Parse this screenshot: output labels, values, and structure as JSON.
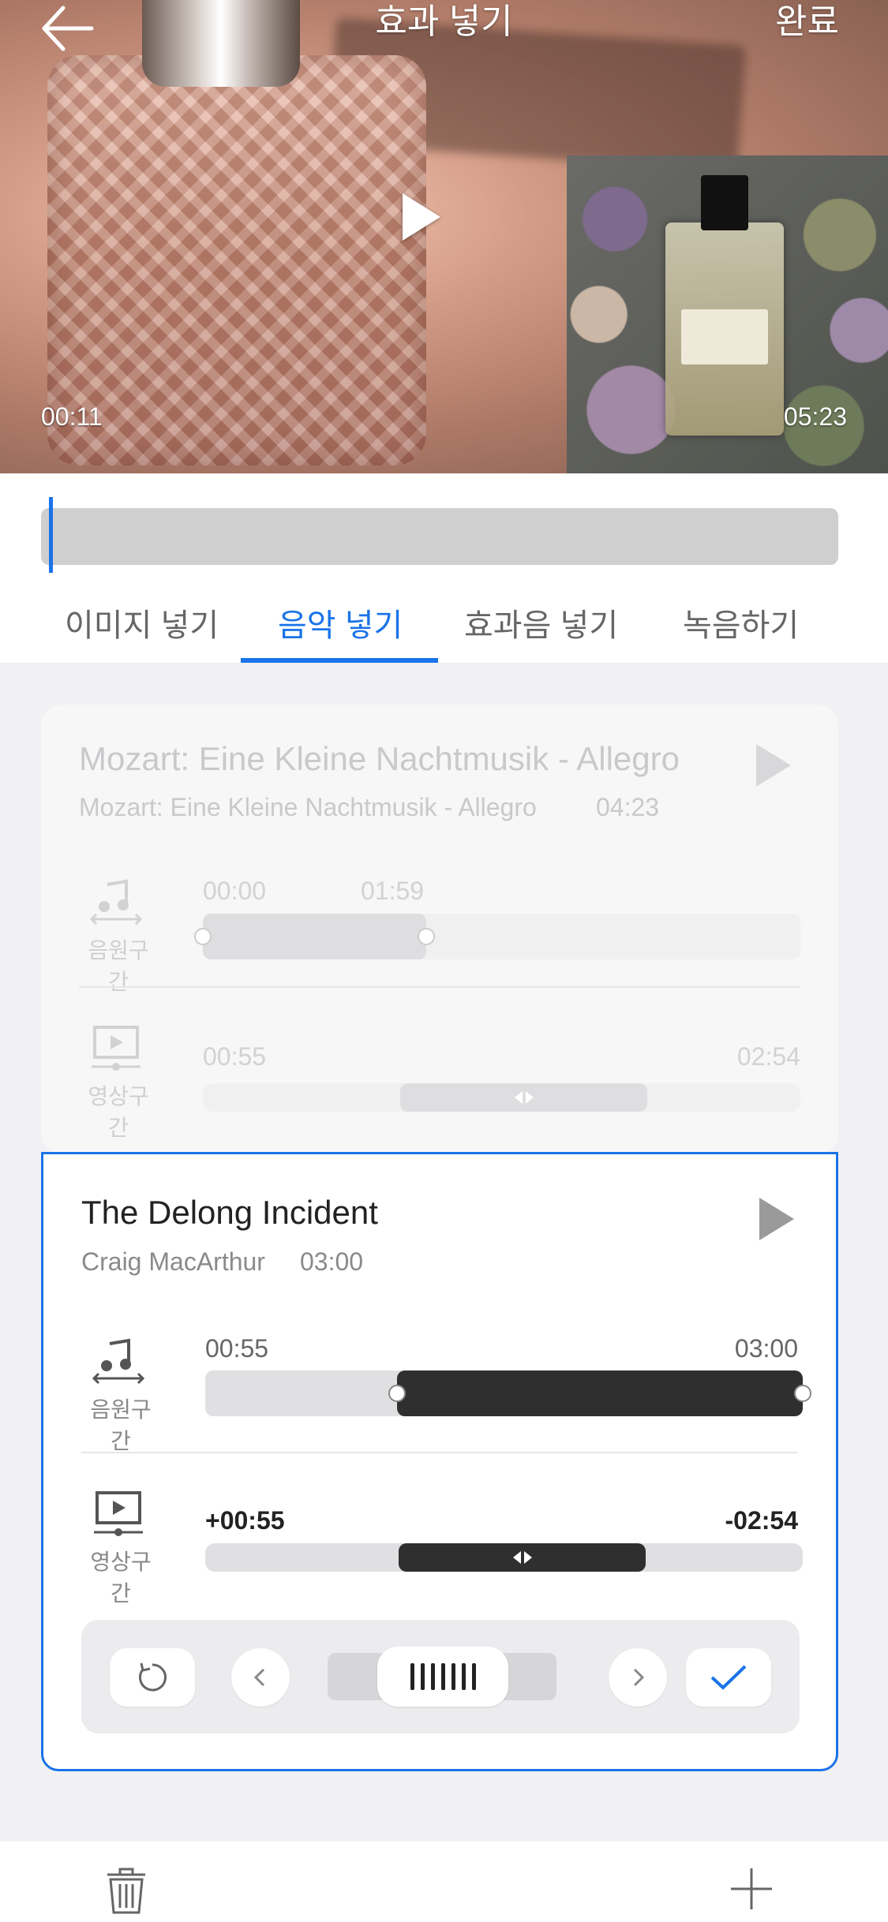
{
  "header": {
    "title": "효과 넣기",
    "done_label": "완료"
  },
  "video": {
    "current_time": "00:11",
    "inset_duration": "05:23"
  },
  "tabs": [
    {
      "label": "이미지 넣기"
    },
    {
      "label": "음악 넣기"
    },
    {
      "label": "효과음 넣기"
    },
    {
      "label": "녹음하기"
    }
  ],
  "active_tab": "음악 넣기",
  "tracks": [
    {
      "title": "Mozart: Eine Kleine Nachtmusik - Allegro",
      "artist": "Mozart: Eine Kleine Nachtmusik - Allegro",
      "duration": "04:23",
      "source_label": "음원구간",
      "source_start": "00:00",
      "source_end": "01:59",
      "video_label": "영상구간",
      "video_start": "00:55",
      "video_end": "02:54"
    },
    {
      "title": "The Delong Incident",
      "artist": "Craig MacArthur",
      "duration": "03:00",
      "source_label": "음원구간",
      "source_start": "00:55",
      "source_end": "03:00",
      "video_label": "영상구간",
      "video_start": "+00:55",
      "video_end": "-02:54"
    }
  ],
  "icons": {
    "back": "arrow-left-icon",
    "play": "play-icon",
    "music": "music-note-icon",
    "video": "video-screen-icon",
    "reset": "reset-icon",
    "prev": "chevron-left-icon",
    "next": "chevron-right-icon",
    "confirm": "check-icon",
    "delete": "trash-icon",
    "add": "plus-icon"
  },
  "colors": {
    "accent": "#1a73e8",
    "selection": "#2f2f30"
  }
}
